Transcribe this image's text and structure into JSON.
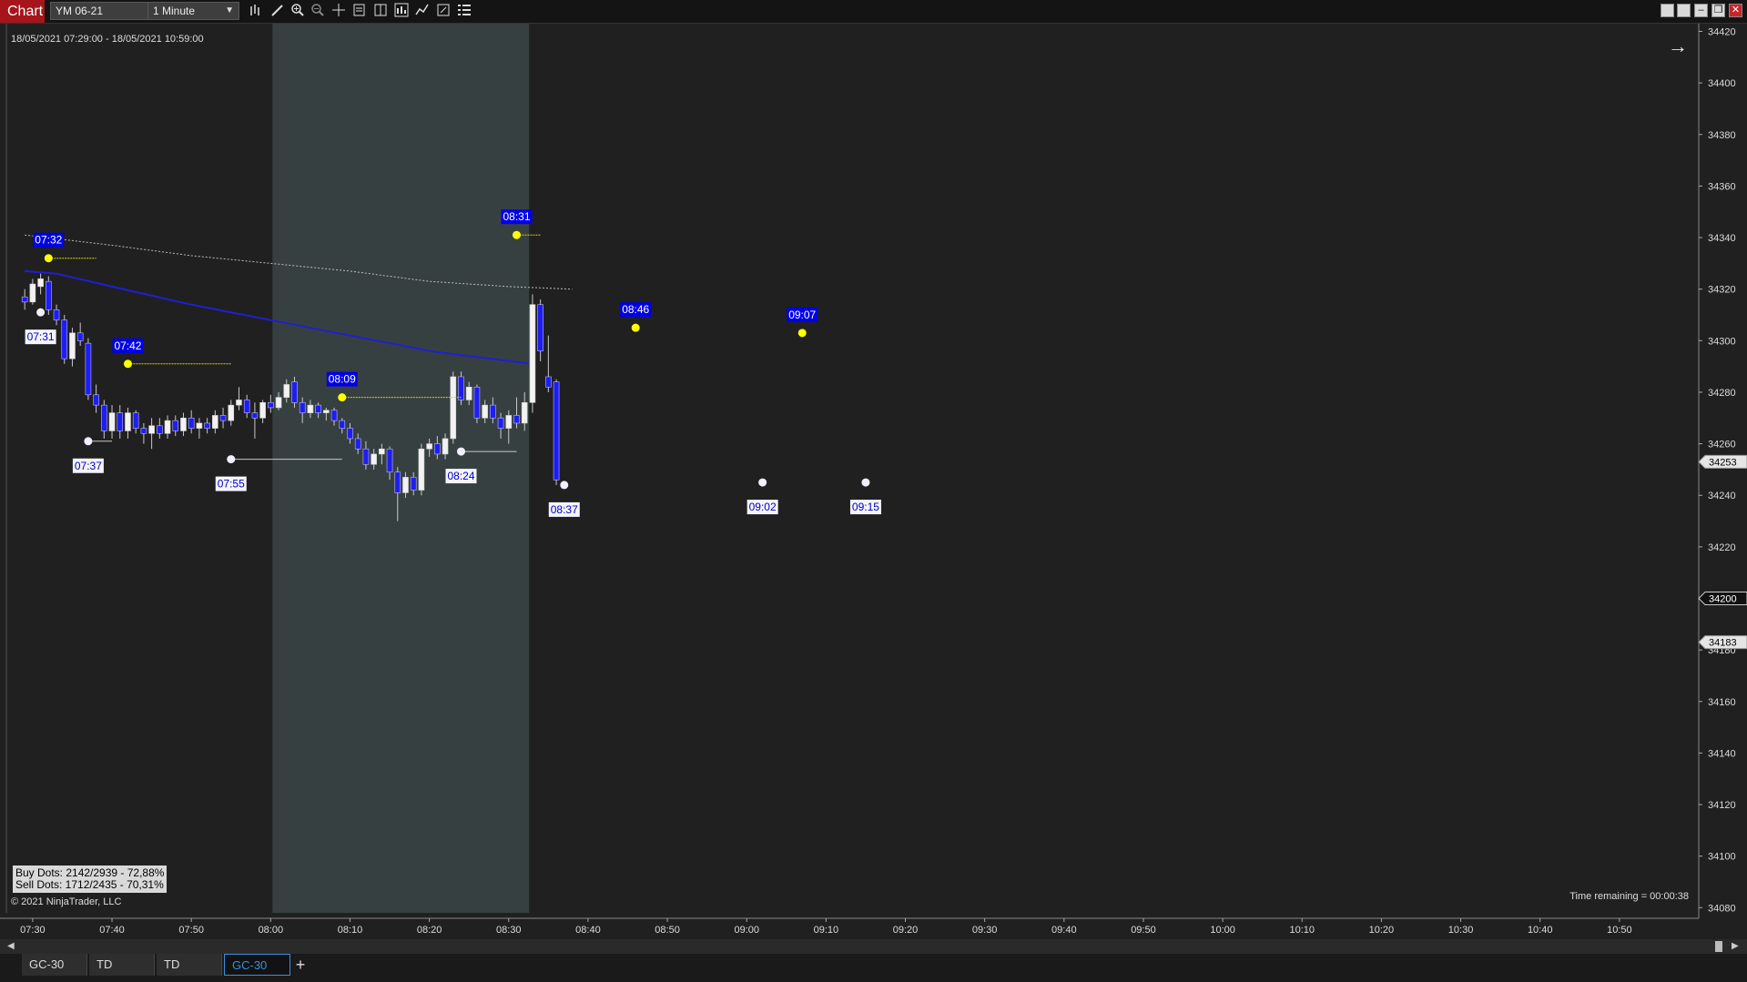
{
  "toolbar": {
    "chart_label": "Chart",
    "instrument": "YM 06-21",
    "interval": "1 Minute"
  },
  "date_range": "18/05/2021 07:29:00 - 18/05/2021 10:59:00",
  "stats": {
    "buy_dots": "Buy Dots: 2142/2939 - 72,88%",
    "sell_dots": "Sell Dots: 1712/2435 - 70,31%"
  },
  "copyright": "© 2021 NinjaTrader, LLC",
  "time_remaining": "Time remaining = 00:00:38",
  "tabs": [
    {
      "label": "GC-30",
      "active": false
    },
    {
      "label": "TD",
      "active": false
    },
    {
      "label": "TD",
      "active": false
    },
    {
      "label": "GC-30",
      "active": true
    }
  ],
  "chart_data": {
    "type": "candlestick",
    "instrument": "YM 06-21",
    "x_ticks": [
      "07:30",
      "07:40",
      "07:50",
      "08:00",
      "08:10",
      "08:20",
      "08:30",
      "08:40",
      "08:50",
      "09:00",
      "09:10",
      "09:20",
      "09:30",
      "09:40",
      "09:50",
      "10:00",
      "10:10",
      "10:20",
      "10:30",
      "10:40",
      "10:50"
    ],
    "y_ticks": [
      34080,
      34100,
      34120,
      34140,
      34160,
      34180,
      34200,
      34220,
      34240,
      34260,
      34280,
      34300,
      34320,
      34340,
      34360,
      34380,
      34400,
      34420
    ],
    "ylim": [
      34078,
      34423
    ],
    "xlim_minutes_from_0730": [
      -3.2,
      210
    ],
    "session_shading": {
      "from": "08:00",
      "to": "08:32",
      "color": "#374040"
    },
    "price_markers": [
      {
        "label": "34253",
        "value": 34253,
        "style": "light"
      },
      {
        "label": "34200",
        "value": 34200,
        "style": "dark"
      },
      {
        "label": "34183",
        "value": 34183,
        "style": "light"
      }
    ],
    "candles": [
      {
        "t": "07:29",
        "o": 34317,
        "h": 34320,
        "l": 34312,
        "c": 34315
      },
      {
        "t": "07:30",
        "o": 34315,
        "h": 34324,
        "l": 34314,
        "c": 34322
      },
      {
        "t": "07:31",
        "o": 34321,
        "h": 34326,
        "l": 34318,
        "c": 34324
      },
      {
        "t": "07:32",
        "o": 34323,
        "h": 34325,
        "l": 34310,
        "c": 34312
      },
      {
        "t": "07:33",
        "o": 34312,
        "h": 34314,
        "l": 34306,
        "c": 34308
      },
      {
        "t": "07:34",
        "o": 34308,
        "h": 34310,
        "l": 34291,
        "c": 34293
      },
      {
        "t": "07:35",
        "o": 34293,
        "h": 34305,
        "l": 34290,
        "c": 34303
      },
      {
        "t": "07:36",
        "o": 34303,
        "h": 34307,
        "l": 34298,
        "c": 34300
      },
      {
        "t": "07:37",
        "o": 34299,
        "h": 34301,
        "l": 34277,
        "c": 34279
      },
      {
        "t": "07:38",
        "o": 34279,
        "h": 34283,
        "l": 34272,
        "c": 34275
      },
      {
        "t": "07:39",
        "o": 34275,
        "h": 34277,
        "l": 34262,
        "c": 34265
      },
      {
        "t": "07:40",
        "o": 34265,
        "h": 34275,
        "l": 34262,
        "c": 34272
      },
      {
        "t": "07:41",
        "o": 34272,
        "h": 34275,
        "l": 34262,
        "c": 34265
      },
      {
        "t": "07:42",
        "o": 34265,
        "h": 34274,
        "l": 34262,
        "c": 34272
      },
      {
        "t": "07:43",
        "o": 34272,
        "h": 34273,
        "l": 34264,
        "c": 34266
      },
      {
        "t": "07:44",
        "o": 34266,
        "h": 34268,
        "l": 34260,
        "c": 34264
      },
      {
        "t": "07:45",
        "o": 34264,
        "h": 34270,
        "l": 34258,
        "c": 34267
      },
      {
        "t": "07:46",
        "o": 34267,
        "h": 34270,
        "l": 34262,
        "c": 34264
      },
      {
        "t": "07:47",
        "o": 34264,
        "h": 34271,
        "l": 34262,
        "c": 34269
      },
      {
        "t": "07:48",
        "o": 34269,
        "h": 34271,
        "l": 34263,
        "c": 34265
      },
      {
        "t": "07:49",
        "o": 34265,
        "h": 34272,
        "l": 34263,
        "c": 34270
      },
      {
        "t": "07:50",
        "o": 34270,
        "h": 34273,
        "l": 34264,
        "c": 34266
      },
      {
        "t": "07:51",
        "o": 34266,
        "h": 34270,
        "l": 34262,
        "c": 34268
      },
      {
        "t": "07:52",
        "o": 34268,
        "h": 34270,
        "l": 34264,
        "c": 34266
      },
      {
        "t": "07:53",
        "o": 34266,
        "h": 34273,
        "l": 34264,
        "c": 34271
      },
      {
        "t": "07:54",
        "o": 34271,
        "h": 34274,
        "l": 34266,
        "c": 34269
      },
      {
        "t": "07:55",
        "o": 34269,
        "h": 34277,
        "l": 34267,
        "c": 34275
      },
      {
        "t": "07:56",
        "o": 34275,
        "h": 34282,
        "l": 34273,
        "c": 34277
      },
      {
        "t": "07:57",
        "o": 34277,
        "h": 34279,
        "l": 34270,
        "c": 34272
      },
      {
        "t": "07:58",
        "o": 34272,
        "h": 34276,
        "l": 34262,
        "c": 34270
      },
      {
        "t": "07:59",
        "o": 34270,
        "h": 34277,
        "l": 34268,
        "c": 34276
      },
      {
        "t": "08:00",
        "o": 34276,
        "h": 34279,
        "l": 34272,
        "c": 34274
      },
      {
        "t": "08:01",
        "o": 34274,
        "h": 34280,
        "l": 34273,
        "c": 34278
      },
      {
        "t": "08:02",
        "o": 34278,
        "h": 34285,
        "l": 34276,
        "c": 34283
      },
      {
        "t": "08:03",
        "o": 34284,
        "h": 34286,
        "l": 34274,
        "c": 34276
      },
      {
        "t": "08:04",
        "o": 34276,
        "h": 34278,
        "l": 34268,
        "c": 34272
      },
      {
        "t": "08:05",
        "o": 34272,
        "h": 34277,
        "l": 34270,
        "c": 34275
      },
      {
        "t": "08:06",
        "o": 34275,
        "h": 34276,
        "l": 34270,
        "c": 34272
      },
      {
        "t": "08:07",
        "o": 34272,
        "h": 34274,
        "l": 34269,
        "c": 34273
      },
      {
        "t": "08:08",
        "o": 34273,
        "h": 34274,
        "l": 34267,
        "c": 34269
      },
      {
        "t": "08:09",
        "o": 34269,
        "h": 34270,
        "l": 34264,
        "c": 34266
      },
      {
        "t": "08:10",
        "o": 34266,
        "h": 34268,
        "l": 34260,
        "c": 34262
      },
      {
        "t": "08:11",
        "o": 34262,
        "h": 34264,
        "l": 34256,
        "c": 34258
      },
      {
        "t": "08:12",
        "o": 34258,
        "h": 34261,
        "l": 34250,
        "c": 34252
      },
      {
        "t": "08:13",
        "o": 34252,
        "h": 34258,
        "l": 34250,
        "c": 34256
      },
      {
        "t": "08:14",
        "o": 34256,
        "h": 34260,
        "l": 34252,
        "c": 34258
      },
      {
        "t": "08:15",
        "o": 34258,
        "h": 34259,
        "l": 34246,
        "c": 34249
      },
      {
        "t": "08:16",
        "o": 34249,
        "h": 34251,
        "l": 34230,
        "c": 34241
      },
      {
        "t": "08:17",
        "o": 34241,
        "h": 34249,
        "l": 34239,
        "c": 34247
      },
      {
        "t": "08:18",
        "o": 34247,
        "h": 34249,
        "l": 34240,
        "c": 34242
      },
      {
        "t": "08:19",
        "o": 34242,
        "h": 34260,
        "l": 34240,
        "c": 34258
      },
      {
        "t": "08:20",
        "o": 34258,
        "h": 34262,
        "l": 34255,
        "c": 34260
      },
      {
        "t": "08:21",
        "o": 34260,
        "h": 34263,
        "l": 34254,
        "c": 34256
      },
      {
        "t": "08:22",
        "o": 34256,
        "h": 34264,
        "l": 34254,
        "c": 34262
      },
      {
        "t": "08:23",
        "o": 34262,
        "h": 34288,
        "l": 34260,
        "c": 34286
      },
      {
        "t": "08:24",
        "o": 34286,
        "h": 34288,
        "l": 34275,
        "c": 34277
      },
      {
        "t": "08:25",
        "o": 34277,
        "h": 34284,
        "l": 34275,
        "c": 34282
      },
      {
        "t": "08:26",
        "o": 34282,
        "h": 34283,
        "l": 34268,
        "c": 34270
      },
      {
        "t": "08:27",
        "o": 34270,
        "h": 34277,
        "l": 34268,
        "c": 34275
      },
      {
        "t": "08:28",
        "o": 34275,
        "h": 34278,
        "l": 34268,
        "c": 34270
      },
      {
        "t": "08:29",
        "o": 34270,
        "h": 34272,
        "l": 34262,
        "c": 34266
      },
      {
        "t": "08:30",
        "o": 34266,
        "h": 34273,
        "l": 34260,
        "c": 34271
      },
      {
        "t": "08:31",
        "o": 34271,
        "h": 34278,
        "l": 34266,
        "c": 34268
      },
      {
        "t": "08:32",
        "o": 34268,
        "h": 34280,
        "l": 34265,
        "c": 34276
      },
      {
        "t": "08:33",
        "o": 34276,
        "h": 34318,
        "l": 34272,
        "c": 34314
      },
      {
        "t": "08:34",
        "o": 34314,
        "h": 34316,
        "l": 34292,
        "c": 34296
      },
      {
        "t": "08:35",
        "o": 34286,
        "h": 34302,
        "l": 34280,
        "c": 34282
      },
      {
        "t": "08:36",
        "o": 34284,
        "h": 34285,
        "l": 34244,
        "c": 34246
      }
    ],
    "moving_averages": [
      {
        "name": "",
        "color": "#1f1fd6",
        "points": [
          [
            "07:29",
            34327
          ],
          [
            "07:33",
            34326
          ],
          [
            "07:40",
            34321
          ],
          [
            "07:50",
            34314
          ],
          [
            "08:00",
            34308
          ],
          [
            "08:10",
            34302
          ],
          [
            "08:20",
            34296
          ],
          [
            "08:25",
            34294
          ],
          [
            "08:33",
            34291
          ]
        ]
      },
      {
        "name": "",
        "color": "#bdbdbd",
        "dashed": true,
        "points": [
          [
            "07:29",
            34341
          ],
          [
            "07:40",
            34337
          ],
          [
            "07:50",
            34333
          ],
          [
            "08:00",
            34330
          ],
          [
            "08:10",
            34327
          ],
          [
            "08:20",
            34323
          ],
          [
            "08:30",
            34321
          ],
          [
            "08:38",
            34320
          ]
        ]
      }
    ],
    "dots": [
      {
        "t": "07:32",
        "price": 34332,
        "color": "yellow",
        "label": "07:32",
        "label_style": "blue",
        "label_pos": "above",
        "line_to": "07:38"
      },
      {
        "t": "07:31",
        "price": 34311,
        "color": "white",
        "label": "07:31",
        "label_style": "white",
        "label_pos": "below"
      },
      {
        "t": "07:42",
        "price": 34291,
        "color": "yellow",
        "label": "07:42",
        "label_style": "blue",
        "label_pos": "above",
        "line_to": "07:55"
      },
      {
        "t": "07:37",
        "price": 34261,
        "color": "white",
        "label": "07:37",
        "label_style": "white",
        "label_pos": "below",
        "line_to": "07:40"
      },
      {
        "t": "07:55",
        "price": 34254,
        "color": "white",
        "label": "07:55",
        "label_style": "white",
        "label_pos": "below",
        "line_to": "08:09"
      },
      {
        "t": "08:09",
        "price": 34278,
        "color": "yellow",
        "label": "08:09",
        "label_style": "blue",
        "label_pos": "above",
        "line_to": "08:24"
      },
      {
        "t": "08:24",
        "price": 34257,
        "color": "white",
        "label": "08:24",
        "label_style": "white",
        "label_pos": "below",
        "line_to": "08:31"
      },
      {
        "t": "08:31",
        "price": 34341,
        "color": "yellow",
        "label": "08:31",
        "label_style": "blue",
        "label_pos": "above",
        "line_to": "08:34"
      },
      {
        "t": "08:37",
        "price": 34244,
        "color": "white",
        "label": "08:37",
        "label_style": "white",
        "label_pos": "below"
      },
      {
        "t": "08:46",
        "price": 34305,
        "color": "yellow",
        "label": "08:46",
        "label_style": "blue",
        "label_pos": "above"
      },
      {
        "t": "09:02",
        "price": 34245,
        "color": "white",
        "label": "09:02",
        "label_style": "white",
        "label_pos": "below"
      },
      {
        "t": "09:07",
        "price": 34303,
        "color": "yellow",
        "label": "09:07",
        "label_style": "blue",
        "label_pos": "above"
      },
      {
        "t": "09:15",
        "price": 34245,
        "color": "white",
        "label": "09:15",
        "label_style": "white",
        "label_pos": "below"
      }
    ]
  }
}
